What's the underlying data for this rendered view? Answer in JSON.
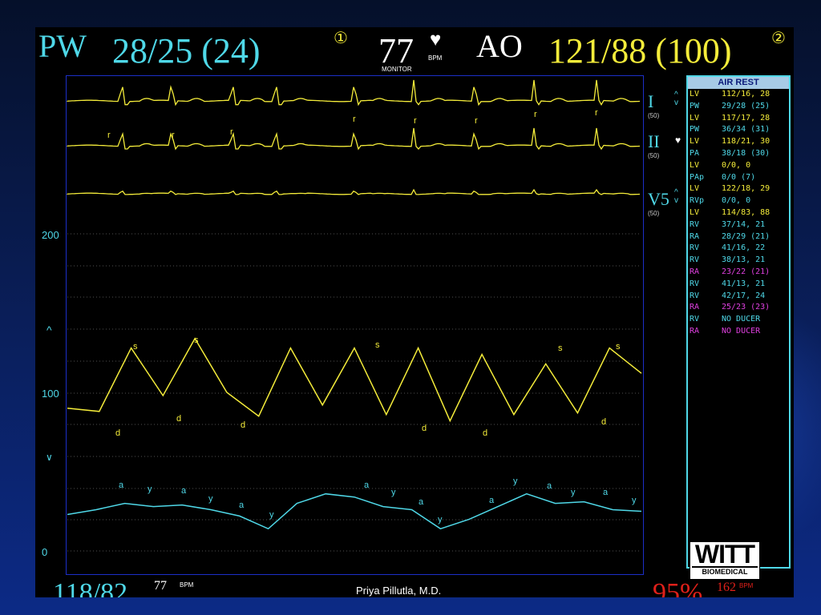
{
  "header": {
    "chan1_label": "PW",
    "chan1_value": "28/25 (24)",
    "chan1_num": "①",
    "hr_value": "77",
    "hr_unit": "BPM",
    "hr_source": "MONITOR",
    "chan2_label": "AO",
    "chan2_value": "121/88 (100)",
    "chan2_num": "②"
  },
  "leads": [
    {
      "name": "I",
      "sub": "(50)"
    },
    {
      "name": "II",
      "sub": "(50)"
    },
    {
      "name": "V5",
      "sub": "(50)"
    }
  ],
  "ecg_marks": [
    "r",
    "r",
    "r",
    "r",
    "r",
    "r",
    "r",
    "r"
  ],
  "pressure_axis": {
    "labels": [
      "200",
      "100",
      "0"
    ]
  },
  "ao_marks": [
    "s",
    "s",
    "s",
    "s",
    "s",
    "d",
    "d",
    "d",
    "d",
    "d",
    "d",
    "d"
  ],
  "pw_marks": [
    "a",
    "y",
    "a",
    "y",
    "a",
    "y",
    "a",
    "y",
    "a",
    "y",
    "a",
    "y",
    "a",
    "y",
    "a",
    "y",
    "a",
    "y"
  ],
  "sidebar": {
    "title": "AIR REST",
    "rows": [
      {
        "site": "LV",
        "value": "112/16, 28",
        "color": "#f4ec3a"
      },
      {
        "site": "PW",
        "value": "29/28 (25)",
        "color": "#4fd8e8"
      },
      {
        "site": "LV",
        "value": "117/17, 28",
        "color": "#f4ec3a"
      },
      {
        "site": "PW",
        "value": "36/34 (31)",
        "color": "#4fd8e8"
      },
      {
        "site": "LV",
        "value": "118/21, 30",
        "color": "#f4ec3a"
      },
      {
        "site": "PA",
        "value": "38/18 (30)",
        "color": "#4fd8e8"
      },
      {
        "site": "LV",
        "value": "0/0, 0",
        "color": "#f4ec3a"
      },
      {
        "site": "PAp",
        "value": "0/0 (7)",
        "color": "#4fd8e8"
      },
      {
        "site": "LV",
        "value": "122/18, 29",
        "color": "#f4ec3a"
      },
      {
        "site": "RVp",
        "value": "0/0, 0",
        "color": "#4fd8e8"
      },
      {
        "site": "LV",
        "value": "114/83, 88",
        "color": "#f4ec3a"
      },
      {
        "site": "RV",
        "value": "37/14, 21",
        "color": "#4fd8e8"
      },
      {
        "site": "RA",
        "value": "28/29 (21)",
        "color": "#4fd8e8"
      },
      {
        "site": "RV",
        "value": "41/16, 22",
        "color": "#4fd8e8"
      },
      {
        "site": "RV",
        "value": "38/13, 21",
        "color": "#4fd8e8"
      },
      {
        "site": "RA",
        "value": "23/22 (21)",
        "color": "#e040e0"
      },
      {
        "site": "RV",
        "value": "41/13, 21",
        "color": "#4fd8e8"
      },
      {
        "site": "RV",
        "value": "42/17, 24",
        "color": "#4fd8e8"
      },
      {
        "site": "RA",
        "value": "25/23 (23)",
        "color": "#e040e0"
      },
      {
        "site": "RV",
        "value": "NO DUCER",
        "color": "#4fd8e8"
      },
      {
        "site": "RA",
        "value": "NO DUCER",
        "color": "#e040e0"
      }
    ]
  },
  "logo": {
    "big": "WITT",
    "small": "BIOMEDICAL"
  },
  "bottom": {
    "left_value": "118/82",
    "left_hr": "77",
    "left_hr_unit": "BPM",
    "right_value": "95%",
    "right_hr": "162",
    "right_hr_unit": "BPM"
  },
  "footer": {
    "author": "Priya Pillutla, M.D."
  },
  "chart_data": {
    "type": "line",
    "title": "",
    "xlabel": "",
    "ylabel": "",
    "ylim": [
      0,
      200
    ],
    "y_ticks": [
      0,
      100,
      200
    ],
    "grid": "dotted horizontal",
    "series": [
      {
        "name": "I",
        "color": "#f4ec3a",
        "values": []
      },
      {
        "name": "II",
        "color": "#f4ec3a",
        "values": []
      },
      {
        "name": "V5",
        "color": "#f4ec3a",
        "values": []
      },
      {
        "name": "AO",
        "color": "#f4ec3a",
        "values": [
          90,
          88,
          128,
          98,
          134,
          100,
          85,
          128,
          92,
          128,
          86,
          128,
          82,
          124,
          86,
          118,
          87,
          128,
          112
        ]
      },
      {
        "name": "PW",
        "color": "#4fd8e8",
        "values": [
          23,
          26,
          30,
          28,
          29,
          26,
          22,
          14,
          30,
          36,
          34,
          28,
          26,
          14,
          20,
          28,
          36,
          30,
          31,
          26,
          25
        ]
      }
    ]
  }
}
